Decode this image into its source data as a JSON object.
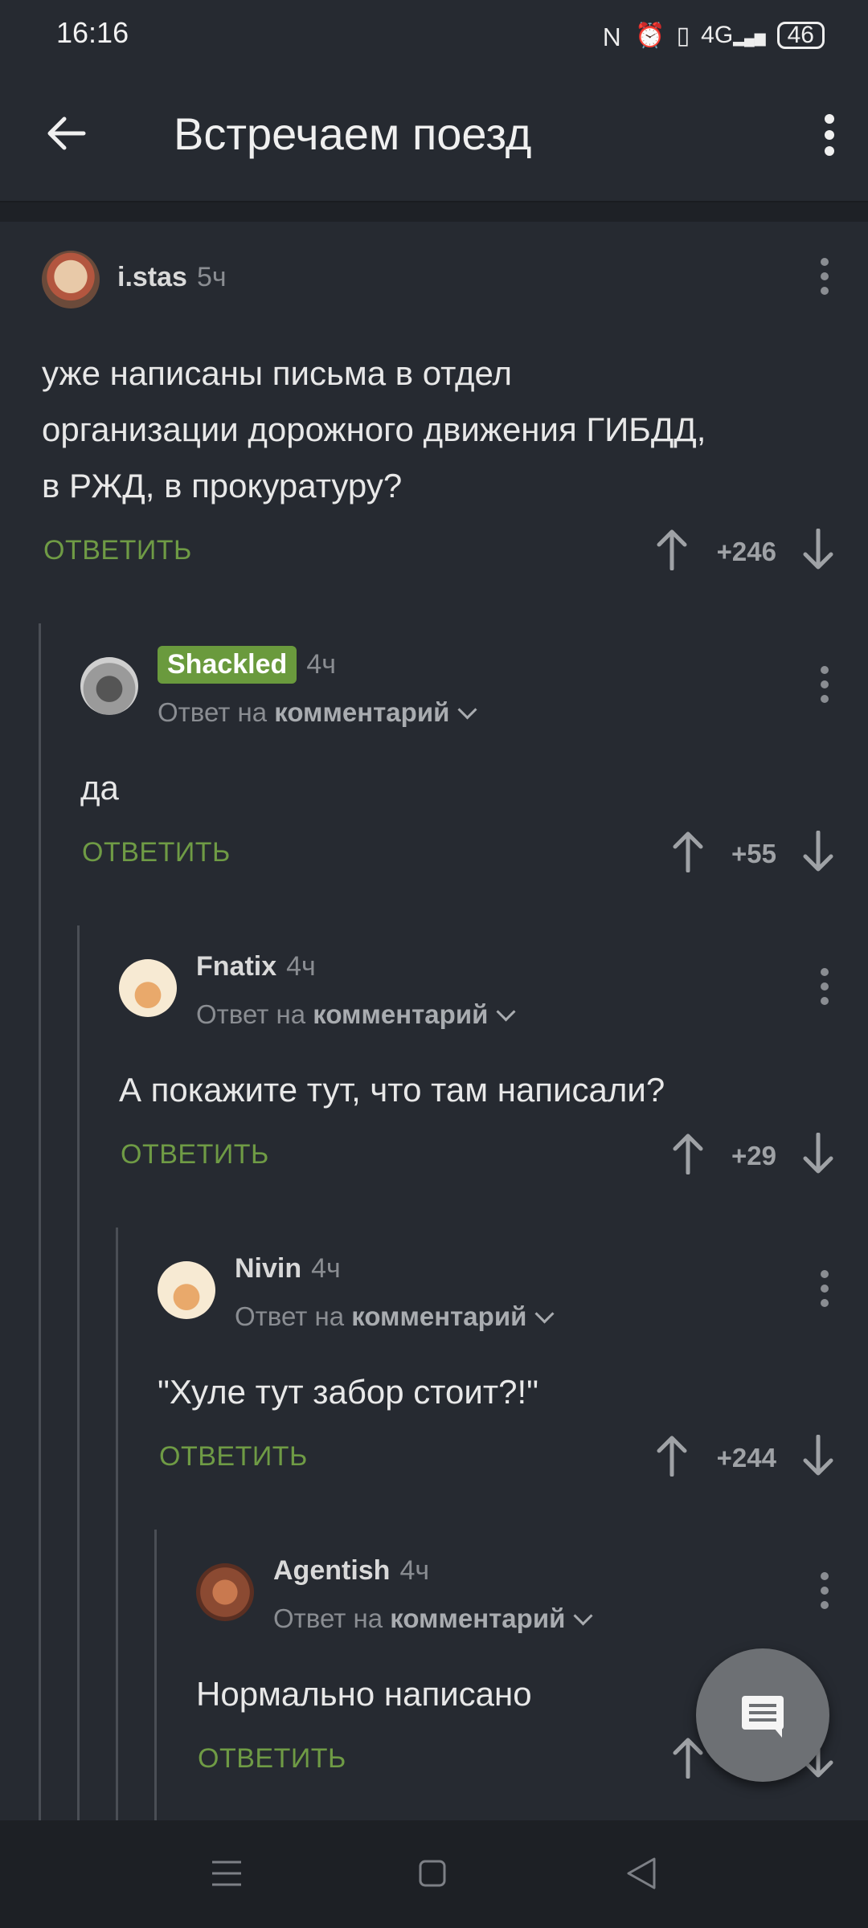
{
  "status": {
    "time": "16:16",
    "network": "4G",
    "battery": "46"
  },
  "header": {
    "title": "Встречаем поезд"
  },
  "comments": [
    {
      "user": "i.stas",
      "time": "5ч",
      "text_lines": [
        "уже написаны письма в отдел",
        "организации дорожного движения ГИБДД,",
        "в РЖД, в прокуратуру?"
      ],
      "reply_label": "ОТВЕТИТЬ",
      "score": "+246"
    },
    {
      "user": "Shackled",
      "time": "4ч",
      "reply_prefix": "Ответ на",
      "reply_target": "комментарий",
      "text_lines": [
        "да"
      ],
      "reply_label": "ОТВЕТИТЬ",
      "score": "+55"
    },
    {
      "user": "Fnatix",
      "time": "4ч",
      "reply_prefix": "Ответ на",
      "reply_target": "комментарий",
      "text_lines": [
        "А покажите тут, что там написали?"
      ],
      "reply_label": "ОТВЕТИТЬ",
      "score": "+29"
    },
    {
      "user": "Nivin",
      "time": "4ч",
      "reply_prefix": "Ответ на",
      "reply_target": "комментарий",
      "text_lines": [
        "\"Хуле тут забор стоит?!\""
      ],
      "reply_label": "ОТВЕТИТЬ",
      "score": "+244"
    },
    {
      "user": "Agentish",
      "time": "4ч",
      "reply_prefix": "Ответ на",
      "reply_target": "комментарий",
      "text_lines": [
        "Нормально написано"
      ],
      "reply_label": "ОТВЕТИТЬ"
    }
  ],
  "colors": {
    "background": "#262a31",
    "accent_green": "#6f9b45",
    "badge_green": "#6a9a3d"
  },
  "icons": [
    "back-arrow-icon",
    "more-vert-icon",
    "upvote-arrow-icon",
    "downvote-arrow-icon",
    "comment-icon",
    "nav-menu-icon",
    "nav-home-icon",
    "nav-back-icon"
  ]
}
